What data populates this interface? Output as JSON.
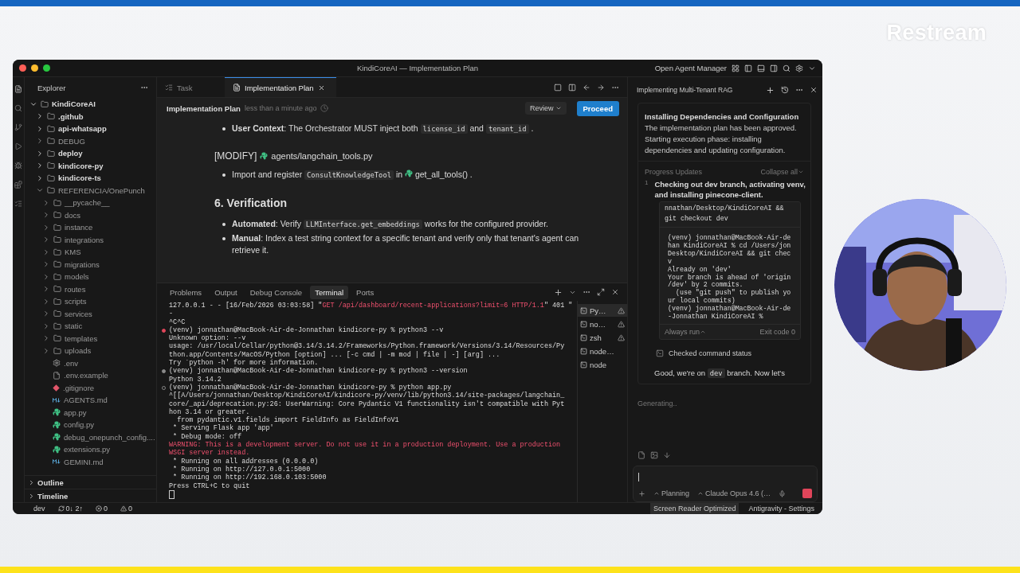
{
  "brand": {
    "logo": "Restream"
  },
  "window": {
    "title": "KindiCoreAI — Implementation Plan",
    "agent_manager": "Open Agent Manager"
  },
  "explorer": {
    "title": "Explorer",
    "tree": [
      {
        "label": "KindiCoreAI",
        "kind": "folder",
        "expanded": true,
        "dimmed": false,
        "children": [
          {
            "label": ".github",
            "kind": "folder",
            "expanded": false,
            "dimmed": false
          },
          {
            "label": "api-whatsapp",
            "kind": "folder",
            "expanded": false,
            "dimmed": false
          },
          {
            "label": "DEBUG",
            "kind": "folder",
            "expanded": false,
            "dimmed": true
          },
          {
            "label": "deploy",
            "kind": "folder",
            "expanded": false,
            "dimmed": false
          },
          {
            "label": "kindicore-py",
            "kind": "folder",
            "expanded": false,
            "dimmed": false
          },
          {
            "label": "kindicore-ts",
            "kind": "folder",
            "expanded": false,
            "dimmed": false
          },
          {
            "label": "REFERENCIA/OnePunch",
            "kind": "folder",
            "expanded": true,
            "dimmed": true,
            "children": [
              {
                "label": "__pycache__",
                "kind": "folder",
                "expanded": false,
                "dimmed": true
              },
              {
                "label": "docs",
                "kind": "folder",
                "expanded": false,
                "dimmed": true
              },
              {
                "label": "instance",
                "kind": "folder",
                "expanded": false,
                "dimmed": true
              },
              {
                "label": "integrations",
                "kind": "folder",
                "expanded": false,
                "dimmed": true
              },
              {
                "label": "KMS",
                "kind": "folder",
                "expanded": false,
                "dimmed": true
              },
              {
                "label": "migrations",
                "kind": "folder",
                "expanded": false,
                "dimmed": true
              },
              {
                "label": "models",
                "kind": "folder",
                "expanded": false,
                "dimmed": true
              },
              {
                "label": "routes",
                "kind": "folder",
                "expanded": false,
                "dimmed": true
              },
              {
                "label": "scripts",
                "kind": "folder",
                "expanded": false,
                "dimmed": true
              },
              {
                "label": "services",
                "kind": "folder",
                "expanded": false,
                "dimmed": true
              },
              {
                "label": "static",
                "kind": "folder",
                "expanded": false,
                "dimmed": true
              },
              {
                "label": "templates",
                "kind": "folder",
                "expanded": false,
                "dimmed": true
              },
              {
                "label": "uploads",
                "kind": "folder",
                "expanded": false,
                "dimmed": true
              },
              {
                "label": ".env",
                "kind": "settings",
                "dimmed": true
              },
              {
                "label": ".env.example",
                "kind": "file",
                "dimmed": true
              },
              {
                "label": ".gitignore",
                "kind": "git",
                "dimmed": true
              },
              {
                "label": "AGENTS.md",
                "kind": "markdown",
                "dimmed": true
              },
              {
                "label": "app.py",
                "kind": "python",
                "dimmed": true
              },
              {
                "label": "config.py",
                "kind": "python",
                "dimmed": true
              },
              {
                "label": "debug_onepunch_config....",
                "kind": "python",
                "dimmed": true
              },
              {
                "label": "extensions.py",
                "kind": "python",
                "dimmed": true
              },
              {
                "label": "GEMINI.md",
                "kind": "markdown",
                "dimmed": true
              }
            ]
          }
        ]
      }
    ],
    "sections": [
      {
        "label": "Outline",
        "expanded": false
      },
      {
        "label": "Timeline",
        "expanded": false
      }
    ]
  },
  "status_bar": {
    "branch": "dev",
    "sync": "0↓ 2↑",
    "errors": "0",
    "warnings": "0",
    "right": [
      "Screen Reader Optimized",
      "Antigravity - Settings"
    ]
  },
  "editor": {
    "tabs": [
      {
        "label": "Task",
        "selected": false
      },
      {
        "label": "Implementation Plan",
        "selected": true
      }
    ],
    "header": {
      "title": "Implementation Plan",
      "time": "less than a minute ago",
      "review": "Review",
      "proceed": "Proceed"
    },
    "blocks": [
      {
        "kind": "bullet",
        "parts": [
          {
            "text": "User Context",
            "kind": "bold"
          },
          {
            "text": ": The Orchestrator MUST inject both ",
            "kind": "plain"
          },
          {
            "text": "license_id",
            "kind": "code"
          },
          {
            "text": " and ",
            "kind": "plain"
          },
          {
            "text": "tenant_id",
            "kind": "code"
          },
          {
            "text": " .",
            "kind": "plain"
          }
        ]
      },
      {
        "kind": "file_heading",
        "tag": "[MODIFY]",
        "file": "agents/langchain_tools.py"
      },
      {
        "kind": "bullet",
        "parts": [
          {
            "text": "Import and register ",
            "kind": "plain"
          },
          {
            "text": "ConsultKnowledgeTool",
            "kind": "code"
          },
          {
            "text": " in ",
            "kind": "plain"
          },
          {
            "text": "get_all_tools()",
            "kind": "symbol"
          },
          {
            "text": " .",
            "kind": "plain"
          }
        ]
      },
      {
        "kind": "heading",
        "text": "6. Verification"
      },
      {
        "kind": "bullet",
        "parts": [
          {
            "text": "Automated",
            "kind": "bold"
          },
          {
            "text": ": Verify ",
            "kind": "plain"
          },
          {
            "text": "LLMInterface.get_embeddings",
            "kind": "code"
          },
          {
            "text": " works for the configured provider.",
            "kind": "plain"
          }
        ]
      },
      {
        "kind": "bullet",
        "parts": [
          {
            "text": "Manual",
            "kind": "bold"
          },
          {
            "text": ": Index a test string context for a specific tenant and verify only that tenant's agent can retrieve it.",
            "kind": "plain"
          }
        ]
      }
    ]
  },
  "panel": {
    "tabs": [
      {
        "label": "Problems",
        "selected": false
      },
      {
        "label": "Output",
        "selected": false
      },
      {
        "label": "Debug Console",
        "selected": false
      },
      {
        "label": "Terminal",
        "selected": true
      },
      {
        "label": "Ports",
        "selected": false
      }
    ],
    "lines": [
      {
        "parts": [
          {
            "text": "127.0.0.1 - - [16/Feb/2026 03:03:58] \"",
            "kind": "plain"
          },
          {
            "text": "GET /api/dashboard/recent-applications?limit=6 HTTP/1.1",
            "kind": "error"
          },
          {
            "text": "\" 401 \"",
            "kind": "plain"
          }
        ]
      },
      {
        "text": "-",
        "kind": "plain"
      },
      {
        "text": "^C^C",
        "kind": "plain"
      },
      {
        "text": "(venv) jonnathan@MacBook-Air-de-Jonnathan kindicore-py % python3 --v",
        "kind": "prompt",
        "failed": true,
        "finished": true
      },
      {
        "text": "Unknown option: --v",
        "kind": "plain"
      },
      {
        "text": "usage: /usr/local/Cellar/python@3.14/3.14.2/Frameworks/Python.framework/Versions/3.14/Resources/Py",
        "kind": "plain"
      },
      {
        "text": "thon.app/Contents/MacOS/Python [option] ... [-c cmd | -m mod | file | -] [arg] ...",
        "kind": "plain"
      },
      {
        "text": "Try `python -h' for more information.",
        "kind": "plain"
      },
      {
        "text": "(venv) jonnathan@MacBook-Air-de-Jonnathan kindicore-py % python3 --version",
        "kind": "prompt",
        "failed": false,
        "finished": true
      },
      {
        "text": "Python 3.14.2",
        "kind": "plain"
      },
      {
        "text": "(venv) jonnathan@MacBook-Air-de-Jonnathan kindicore-py % python app.py",
        "kind": "prompt",
        "failed": false,
        "finished": false
      },
      {
        "text": "^[[A/Users/jonnathan/Desktop/KindiCoreAI/kindicore-py/venv/lib/python3.14/site-packages/langchain_",
        "kind": "plain"
      },
      {
        "text": "core/_api/deprecation.py:26: UserWarning: Core Pydantic V1 functionality isn't compatible with Pyt",
        "kind": "plain"
      },
      {
        "text": "hon 3.14 or greater.",
        "kind": "plain"
      },
      {
        "text": "  from pydantic.v1.fields import FieldInfo as FieldInfoV1",
        "kind": "plain"
      },
      {
        "text": " * Serving Flask app 'app'",
        "kind": "plain"
      },
      {
        "text": " * Debug mode: off",
        "kind": "plain"
      },
      {
        "text": "WARNING: This is a development server. Do not use it in a production deployment. Use a production",
        "kind": "error"
      },
      {
        "text": "WSGI server instead.",
        "kind": "error"
      },
      {
        "text": " * Running on all addresses (0.0.0.0)",
        "kind": "plain"
      },
      {
        "text": " * Running on http://127.0.0.1:5000",
        "kind": "plain"
      },
      {
        "text": " * Running on http://192.168.0.103:5000",
        "kind": "plain"
      },
      {
        "text": "Press CTRL+C to quit",
        "kind": "plain"
      }
    ],
    "terminals": [
      {
        "label": "Py…",
        "warning": true,
        "selected": true
      },
      {
        "label": "no…",
        "warning": true,
        "selected": false
      },
      {
        "label": "zsh",
        "warning": true,
        "selected": false
      },
      {
        "label": "node…",
        "warning": false,
        "selected": false
      },
      {
        "label": "node",
        "warning": false,
        "selected": false
      }
    ]
  },
  "agent": {
    "title": "Implementing Multi-Tenant RAG",
    "task": {
      "title": "Installing Dependencies and Configuration",
      "text": "The implementation plan has been approved. Starting execution phase: installing dependencies and updating configuration."
    },
    "progress": {
      "label": "Progress Updates",
      "collapse": "Collapse all",
      "step": {
        "number": "1",
        "text": "Checking out dev branch, activating venv, and installing pinecone-client.",
        "command": [
          "nnathan/Desktop/KindiCoreAI &&",
          "git checkout dev"
        ],
        "output": [
          "(venv) jonnathan@MacBook-Air-de",
          "han KindiCoreAI % cd /Users/jon",
          "Desktop/KindiCoreAI && git chec",
          "v",
          "Already on 'dev'",
          "Your branch is ahead of 'origin",
          "/dev' by 2 commits.",
          "  (use \"git push\" to publish yo",
          "ur local commits)",
          "(venv) jonnathan@MacBook-Air-de",
          "-Jonnathan KindiCoreAI %"
        ],
        "always_run": "Always run",
        "exit_code": "Exit code 0"
      },
      "status": "Checked command status",
      "message": [
        {
          "text": "Good, we're on ",
          "kind": "plain"
        },
        {
          "text": "dev",
          "kind": "code"
        },
        {
          "text": " branch. Now let's",
          "kind": "plain"
        }
      ]
    },
    "generating": "Generating..",
    "mode": "Planning",
    "model": "Claude Opus 4.6 (…"
  }
}
